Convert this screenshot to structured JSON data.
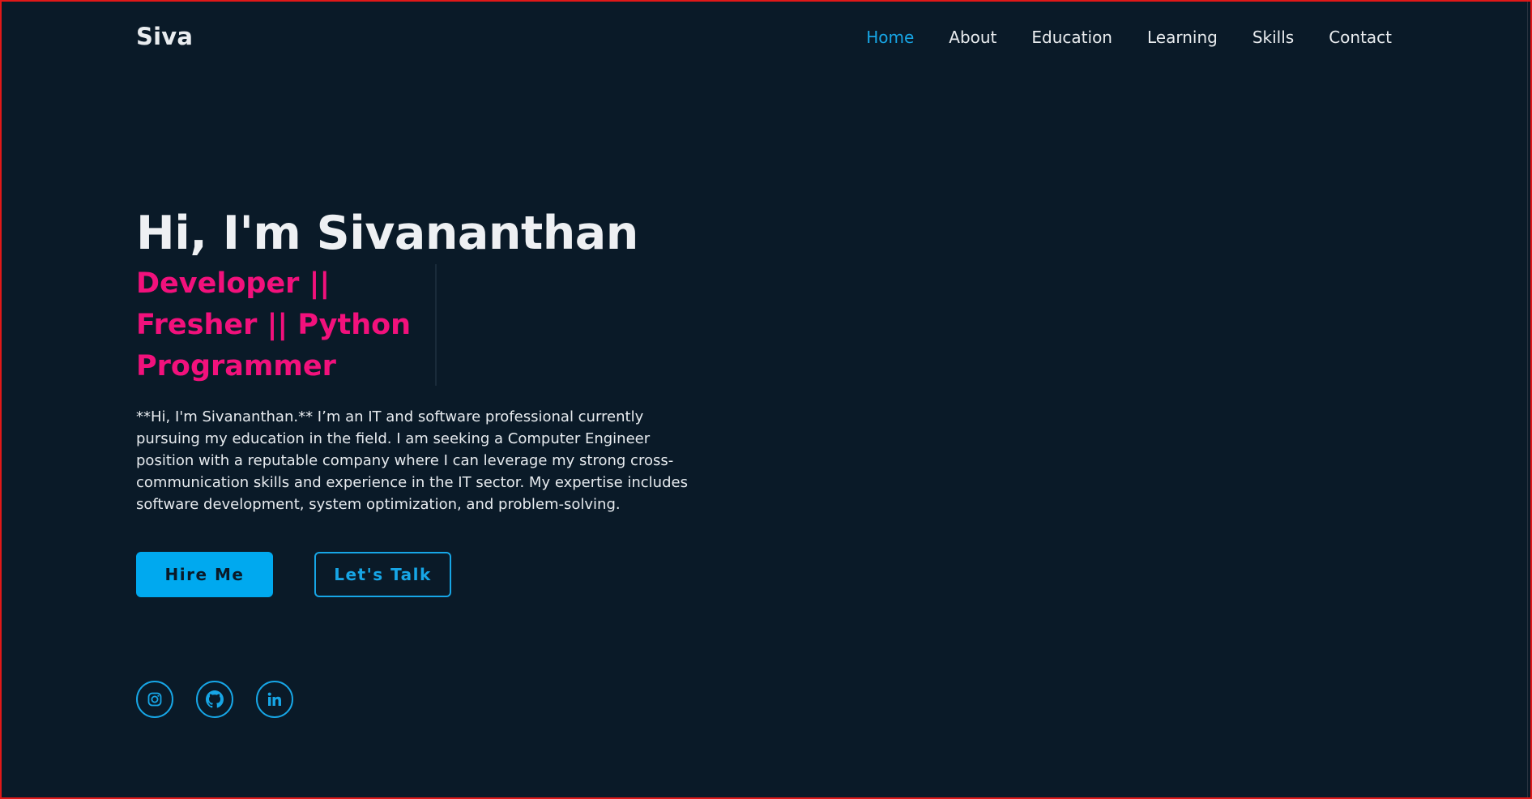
{
  "brand": "Siva",
  "nav": {
    "items": [
      "Home",
      "About",
      "Education",
      "Learning",
      "Skills",
      "Contact"
    ],
    "active": "Home"
  },
  "hero": {
    "title": "Hi, I'm Sivananthan",
    "typed_text": "Developer || Fresher || Python Programmer",
    "description": "**Hi, I'm Sivananthan.** I’m an IT and software professional currently pursuing my education in the field. I am seeking a Computer Engineer position with a reputable company where I can leverage my strong cross-communication skills and experience in the IT sector. My expertise includes software development, system optimization, and problem-solving."
  },
  "buttons": {
    "hire": "Hire Me",
    "talk": "Let's Talk"
  },
  "social": {
    "icons": [
      "instagram-icon",
      "github-icon",
      "linkedin-icon"
    ]
  },
  "colors": {
    "background": "#0a1a28",
    "accent": "#17a6e6",
    "highlight": "#f2117c",
    "text": "#e9ecef",
    "frame_border": "#e01818"
  }
}
